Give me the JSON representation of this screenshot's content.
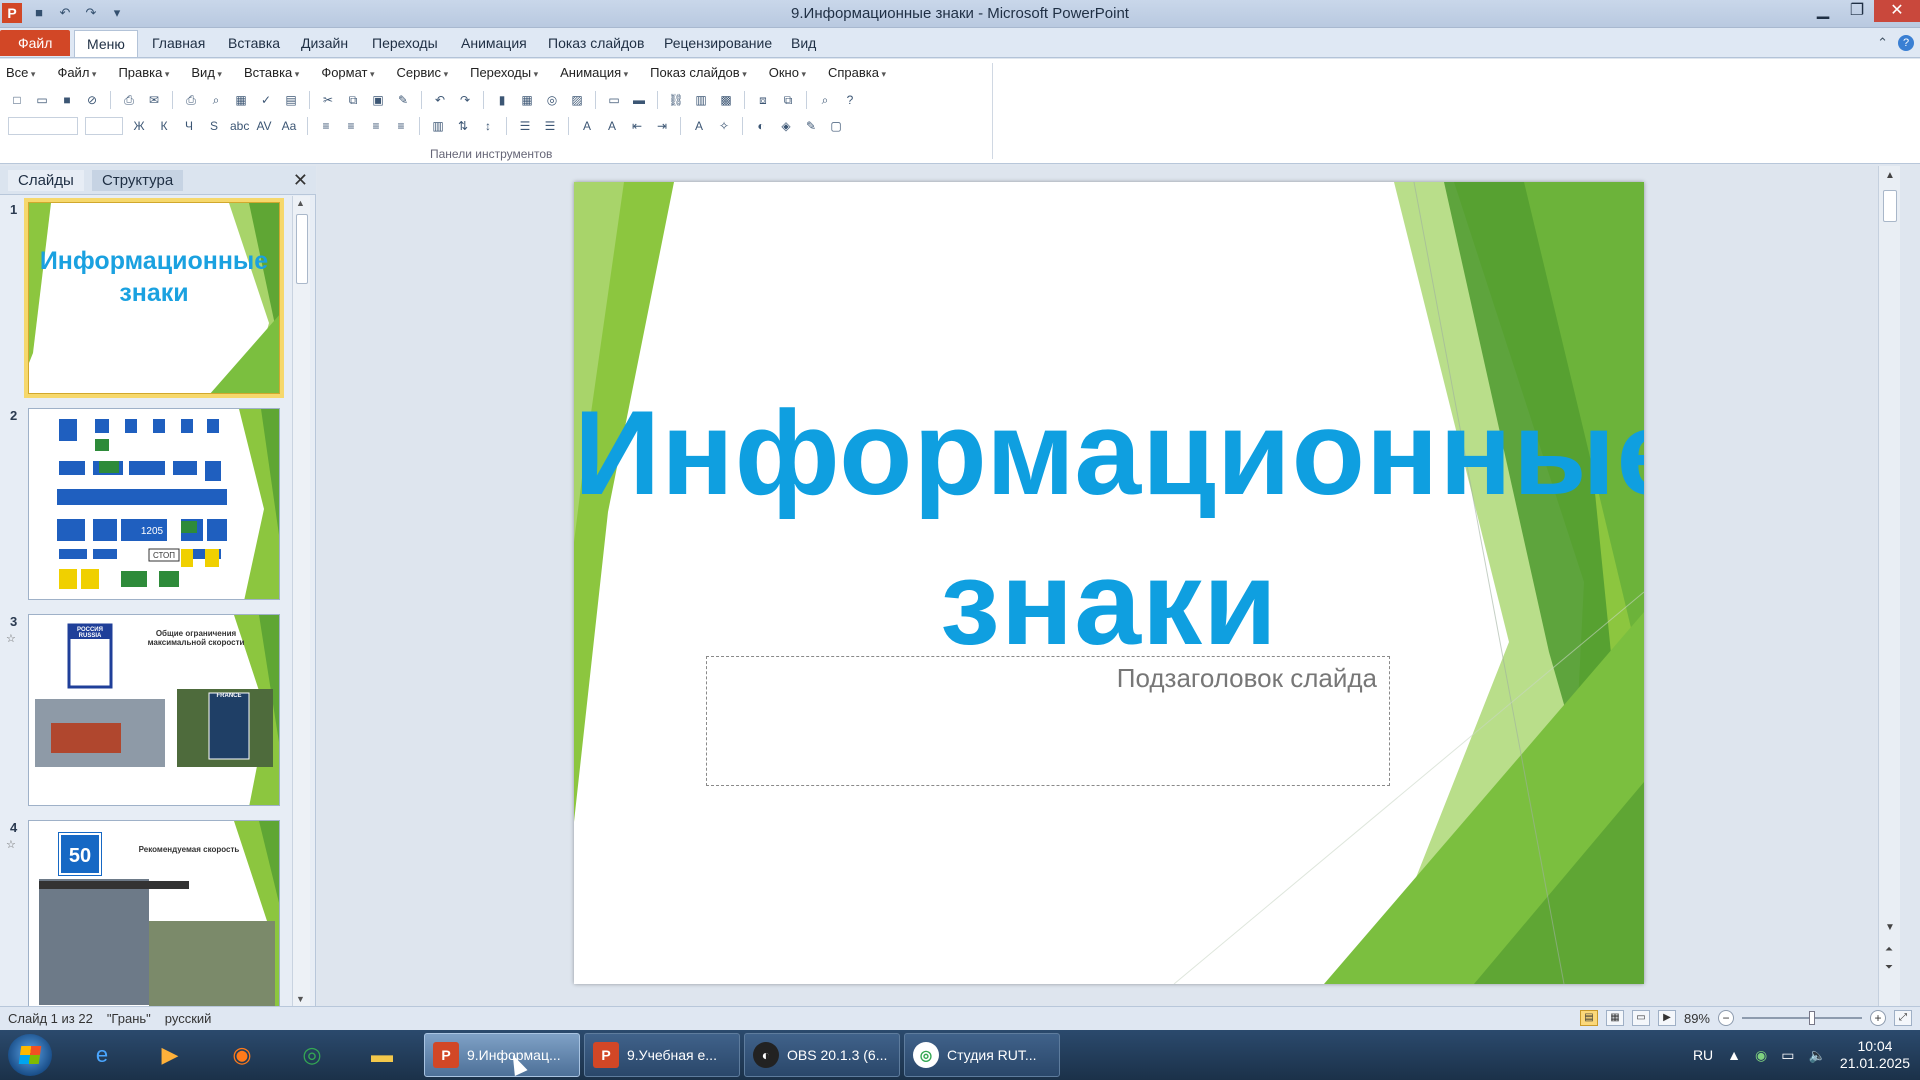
{
  "window": {
    "title": "9.Информационные знаки - Microsoft PowerPoint",
    "app_letter": "P",
    "controls": [
      "minimize",
      "maximize",
      "close"
    ]
  },
  "ribbon": {
    "tabs": [
      {
        "label": "Файл"
      },
      {
        "label": "Меню"
      },
      {
        "label": "Главная"
      },
      {
        "label": "Вставка"
      },
      {
        "label": "Дизайн"
      },
      {
        "label": "Переходы"
      },
      {
        "label": "Анимация"
      },
      {
        "label": "Показ слайдов"
      },
      {
        "label": "Рецензирование"
      },
      {
        "label": "Вид"
      }
    ],
    "active_tab": "Меню",
    "menu_items": [
      "Все",
      "Файл",
      "Правка",
      "Вид",
      "Вставка",
      "Формат",
      "Сервис",
      "Переходы",
      "Анимация",
      "Показ слайдов",
      "Окно",
      "Справка"
    ],
    "group_label": "Панели инструментов"
  },
  "panel": {
    "tabs": [
      "Слайды",
      "Структура"
    ],
    "active_tab": "Слайды",
    "slides": [
      {
        "number": "1",
        "title_line1": "Информационные",
        "title_line2": "знаки"
      },
      {
        "number": "2"
      },
      {
        "number": "3",
        "caption": "Общие ограничения максимальной скорости",
        "sign_text": "РОССИЯ RUSSIA",
        "sign2_text": "FRANCE"
      },
      {
        "number": "4",
        "caption": "Рекомендуемая скорость",
        "sign_value": "50"
      }
    ]
  },
  "slide": {
    "title_line1": "Информационные",
    "title_line2": "знаки",
    "subtitle_placeholder": "Подзаголовок слайда"
  },
  "status": {
    "slide_info": "Слайд 1 из 22",
    "theme": "\"Грань\"",
    "language": "русский",
    "zoom": "89%"
  },
  "taskbar": {
    "tasks": [
      {
        "label": "9.Информац...",
        "active": true
      },
      {
        "label": "9.Учебная е..."
      },
      {
        "label": "OBS 20.1.3 (6..."
      },
      {
        "label": "Студия RUT..."
      }
    ],
    "lang": "RU",
    "time": "10:04",
    "date": "21.01.2025"
  },
  "colors": {
    "accent_title": "#0f9fe0",
    "file_tab": "#d24726",
    "green_dark": "#4e9a2f",
    "green_light": "#8cc63f"
  }
}
